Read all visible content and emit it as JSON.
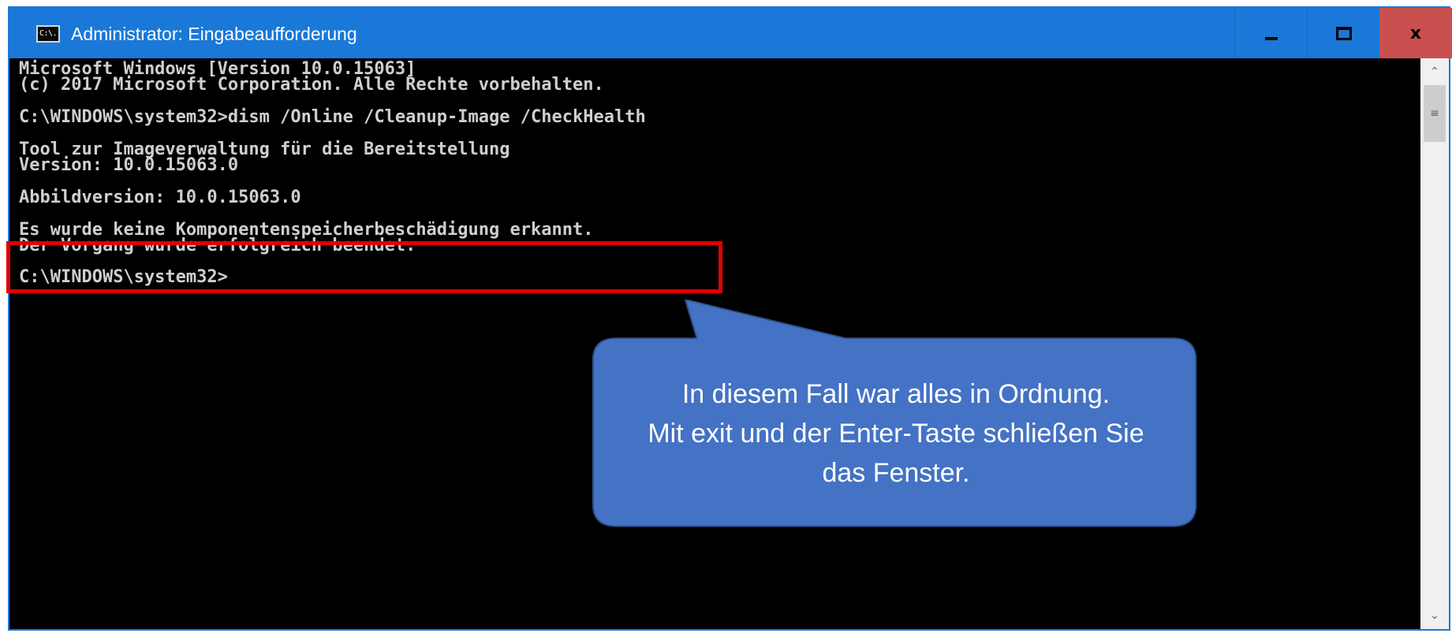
{
  "window": {
    "title": "Administrator: Eingabeaufforderung",
    "icon_label": "C:\\.",
    "icon": "cmd-icon",
    "controls": {
      "minimize_icon": "minimize-icon",
      "maximize_icon": "maximize-icon",
      "close_icon": "close-icon",
      "close_glyph": "x"
    },
    "accent_color": "#1a78d8",
    "close_color": "#c94f4f"
  },
  "console": {
    "lines": [
      "Microsoft Windows [Version 10.0.15063]",
      "(c) 2017 Microsoft Corporation. Alle Rechte vorbehalten.",
      "",
      "C:\\WINDOWS\\system32>dism /Online /Cleanup-Image /CheckHealth",
      "",
      "Tool zur Imageverwaltung für die Bereitstellung",
      "Version: 10.0.15063.0",
      "",
      "Abbildversion: 10.0.15063.0",
      "",
      "Es wurde keine Komponentenspeicherbeschädigung erkannt.",
      "Der Vorgang wurde erfolgreich beendet.",
      "",
      "C:\\WINDOWS\\system32>"
    ]
  },
  "scrollbar": {
    "up_icon": "chevron-up-icon",
    "thumb_icon": "grip-icon",
    "down_icon": "chevron-down-icon"
  },
  "annotation": {
    "highlight_color": "#e00000",
    "callout_color": "#4472c4",
    "callout_lines": [
      "In diesem Fall war alles in Ordnung.",
      "Mit exit und der Enter-Taste schließen Sie",
      "das Fenster."
    ]
  }
}
